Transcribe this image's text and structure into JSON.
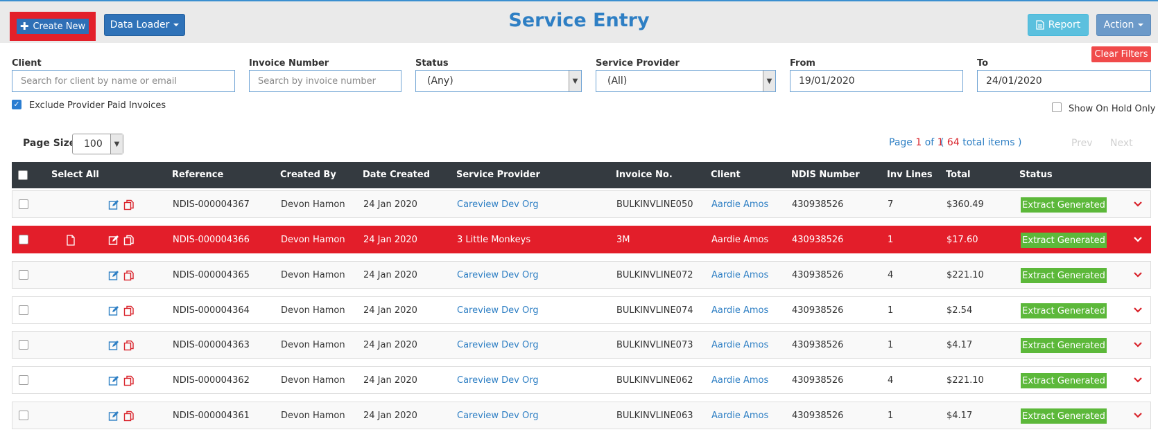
{
  "header": {
    "title": "Service Entry",
    "create_new": "Create New",
    "data_loader": "Data Loader",
    "report": "Report",
    "action": "Action"
  },
  "filters": {
    "client_label": "Client",
    "client_placeholder": "Search for client by name or email",
    "invoice_label": "Invoice Number",
    "invoice_placeholder": "Search by invoice number",
    "status_label": "Status",
    "status_value": "(Any)",
    "provider_label": "Service Provider",
    "provider_value": "(All)",
    "from_label": "From",
    "from_value": "19/01/2020",
    "to_label": "To",
    "to_value": "24/01/2020",
    "clear": "Clear Filters",
    "exclude_paid": "Exclude Provider Paid Invoices",
    "show_on_hold": "Show On Hold Only"
  },
  "pager": {
    "page_size_label": "Page Size:",
    "page_size": "100",
    "page_prefix": "Page",
    "page_current": "1",
    "page_of": "of",
    "page_total": "1",
    "total_items": "64",
    "total_suffix": "total items )",
    "total_prefix": "(",
    "prev": "Prev",
    "next": "Next"
  },
  "table": {
    "columns": [
      "Select All",
      "Reference",
      "Created By",
      "Date Created",
      "Service Provider",
      "Invoice No.",
      "Client",
      "NDIS Number",
      "Inv Lines",
      "Total",
      "Status"
    ],
    "rows": [
      {
        "ref": "NDIS-000004367",
        "by": "Devon Hamon",
        "date": "24 Jan 2020",
        "provider": "Careview Dev Org",
        "inv": "BULKINVLINE050",
        "client": "Aardie Amos",
        "ndis": "430938526",
        "lines": "7",
        "total": "$360.49",
        "status": "Extract Generated"
      },
      {
        "ref": "NDIS-000004366",
        "by": "Devon Hamon",
        "date": "24 Jan 2020",
        "provider": "3 Little Monkeys",
        "inv": "3M",
        "client": "Aardie Amos",
        "ndis": "430938526",
        "lines": "1",
        "total": "$17.60",
        "status": "Extract Generated"
      },
      {
        "ref": "NDIS-000004365",
        "by": "Devon Hamon",
        "date": "24 Jan 2020",
        "provider": "Careview Dev Org",
        "inv": "BULKINVLINE072",
        "client": "Aardie Amos",
        "ndis": "430938526",
        "lines": "4",
        "total": "$221.10",
        "status": "Extract Generated"
      },
      {
        "ref": "NDIS-000004364",
        "by": "Devon Hamon",
        "date": "24 Jan 2020",
        "provider": "Careview Dev Org",
        "inv": "BULKINVLINE074",
        "client": "Aardie Amos",
        "ndis": "430938526",
        "lines": "1",
        "total": "$2.54",
        "status": "Extract Generated"
      },
      {
        "ref": "NDIS-000004363",
        "by": "Devon Hamon",
        "date": "24 Jan 2020",
        "provider": "Careview Dev Org",
        "inv": "BULKINVLINE073",
        "client": "Aardie Amos",
        "ndis": "430938526",
        "lines": "1",
        "total": "$4.17",
        "status": "Extract Generated"
      },
      {
        "ref": "NDIS-000004362",
        "by": "Devon Hamon",
        "date": "24 Jan 2020",
        "provider": "Careview Dev Org",
        "inv": "BULKINVLINE062",
        "client": "Aardie Amos",
        "ndis": "430938526",
        "lines": "4",
        "total": "$221.10",
        "status": "Extract Generated"
      },
      {
        "ref": "NDIS-000004361",
        "by": "Devon Hamon",
        "date": "24 Jan 2020",
        "provider": "Careview Dev Org",
        "inv": "BULKINVLINE063",
        "client": "Aardie Amos",
        "ndis": "430938526",
        "lines": "1",
        "total": "$4.17",
        "status": "Extract Generated"
      }
    ]
  }
}
